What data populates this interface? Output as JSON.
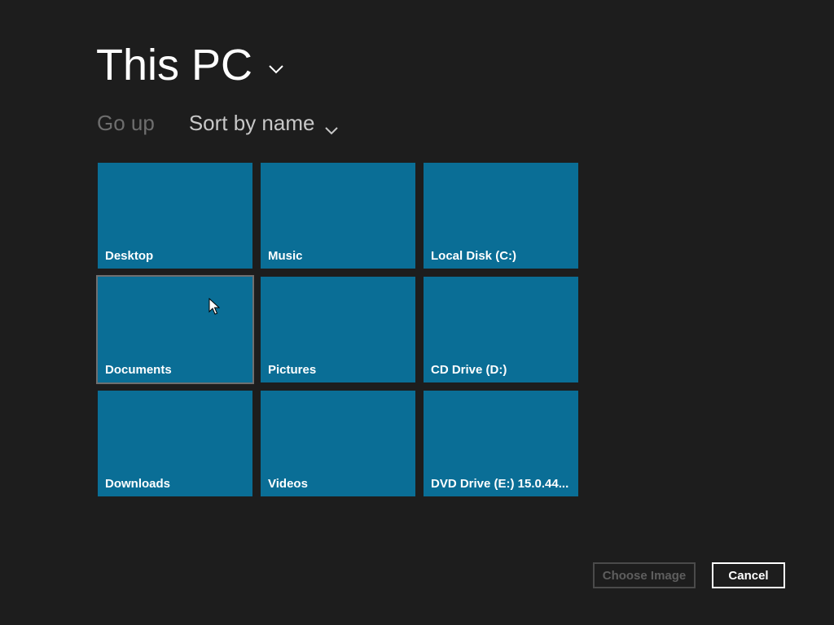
{
  "location": {
    "title": "This PC",
    "dropdown_icon": "chevron-down-icon"
  },
  "commands": {
    "go_up": "Go up",
    "sort": "Sort by name",
    "sort_icon": "chevron-down-icon"
  },
  "tiles": [
    {
      "label": "Desktop"
    },
    {
      "label": "Music"
    },
    {
      "label": "Local Disk (C:)"
    },
    {
      "label": "Documents"
    },
    {
      "label": "Pictures"
    },
    {
      "label": "CD Drive (D:)"
    },
    {
      "label": "Downloads"
    },
    {
      "label": "Videos"
    },
    {
      "label": "DVD Drive (E:) 15.0.44..."
    }
  ],
  "buttons": {
    "choose": "Choose Image",
    "cancel": "Cancel"
  },
  "colors": {
    "background": "#1d1d1d",
    "tile": "#0a6e96",
    "text": "#ffffff",
    "disabled": "#5e5e5e"
  }
}
